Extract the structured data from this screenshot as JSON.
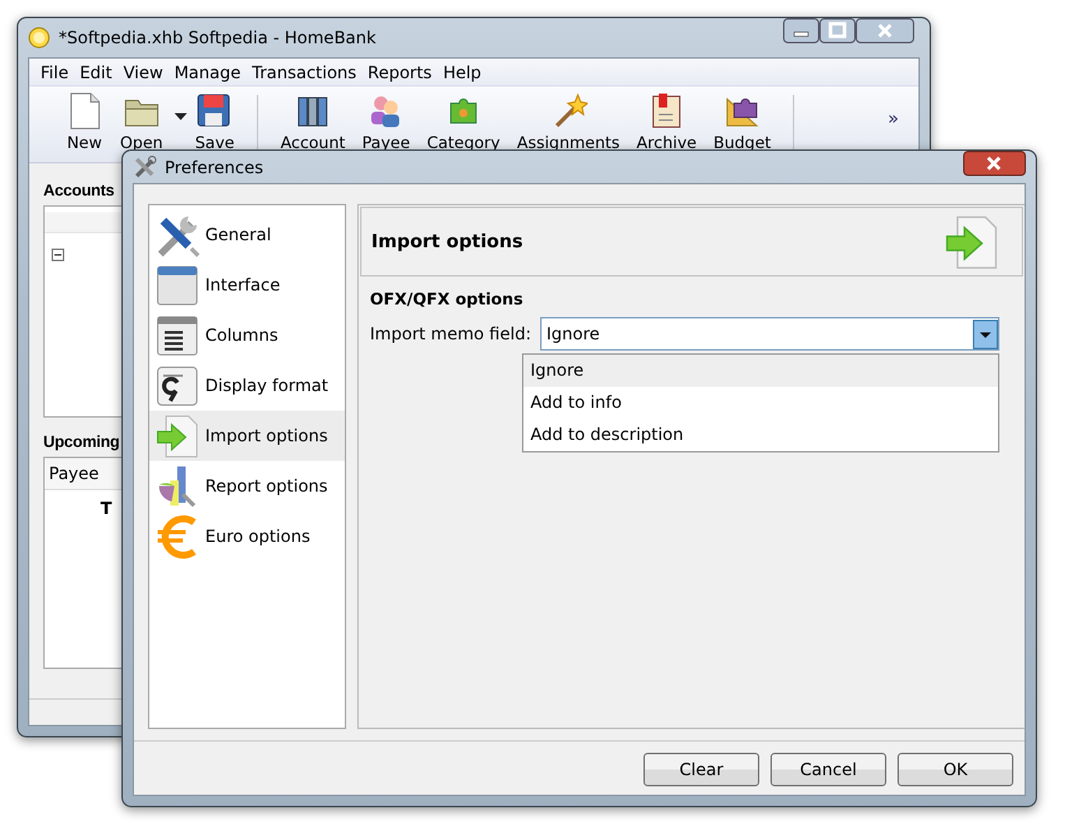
{
  "main_window": {
    "title": "*Softpedia.xhb Softpedia - HomeBank",
    "menu": [
      "File",
      "Edit",
      "View",
      "Manage",
      "Transactions",
      "Reports",
      "Help"
    ],
    "toolbar": [
      {
        "kind": "new",
        "label": "New"
      },
      {
        "kind": "open",
        "label": "Open"
      },
      {
        "kind": "save",
        "label": "Save"
      },
      {
        "kind": "account",
        "label": "Account"
      },
      {
        "kind": "payee",
        "label": "Payee"
      },
      {
        "kind": "category",
        "label": "Category"
      },
      {
        "kind": "assign",
        "label": "Assignments"
      },
      {
        "kind": "archive",
        "label": "Archive"
      },
      {
        "kind": "budget",
        "label": "Budget"
      }
    ],
    "overflow": "»",
    "accounts_heading": "Accounts",
    "upcoming_heading": "Upcoming",
    "upcoming_column": "Payee",
    "upcoming_total": "T"
  },
  "dialog": {
    "title": "Preferences",
    "sidebar": [
      {
        "kind": "general",
        "label": "General",
        "selected": false
      },
      {
        "kind": "interface",
        "label": "Interface",
        "selected": false
      },
      {
        "kind": "columns",
        "label": "Columns",
        "selected": false
      },
      {
        "kind": "display",
        "label": "Display format",
        "selected": false
      },
      {
        "kind": "import",
        "label": "Import options",
        "selected": true
      },
      {
        "kind": "report",
        "label": "Report options",
        "selected": false
      },
      {
        "kind": "euro",
        "label": "Euro options",
        "selected": false
      }
    ],
    "page_title": "Import options",
    "section": "OFX/QFX options",
    "field_label": "Import memo field:",
    "combo": {
      "value": "Ignore",
      "expanded": true
    },
    "options": [
      {
        "label": "Ignore",
        "selected": true
      },
      {
        "label": "Add to info",
        "selected": false
      },
      {
        "label": "Add to description",
        "selected": false
      }
    ],
    "buttons": [
      "Clear",
      "Cancel",
      "OK"
    ]
  }
}
